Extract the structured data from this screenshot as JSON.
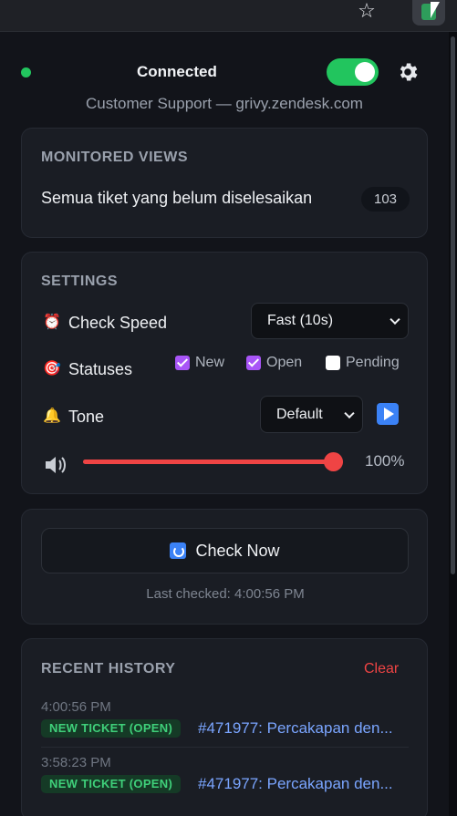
{
  "browser": {
    "star_icon": "star-icon",
    "extension_icon": "extension-icon"
  },
  "header": {
    "status_label": "Connected",
    "connected": true,
    "subtitle": "Customer Support — grivy.zendesk.com"
  },
  "monitored_views": {
    "title": "MONITORED VIEWS",
    "items": [
      {
        "label": "Semua tiket yang belum diselesaikan",
        "count": "103"
      }
    ]
  },
  "settings": {
    "title": "SETTINGS",
    "check_speed": {
      "icon": "alarm-clock-icon",
      "label": "Check Speed",
      "value": "Fast (10s)"
    },
    "statuses": {
      "icon": "target-icon",
      "label": "Statuses",
      "options": [
        {
          "label": "New",
          "checked": true
        },
        {
          "label": "Open",
          "checked": true
        },
        {
          "label": "Pending",
          "checked": false
        }
      ]
    },
    "tone": {
      "icon": "bell-icon",
      "label": "Tone",
      "value": "Default"
    },
    "volume": {
      "value_label": "100%",
      "fraction": 1.0
    }
  },
  "check": {
    "button_label": "Check Now",
    "last_checked": "Last checked: 4:00:56 PM"
  },
  "history": {
    "title": "RECENT HISTORY",
    "clear_label": "Clear",
    "items": [
      {
        "time": "4:00:56 PM",
        "tag": "NEW TICKET (OPEN)",
        "title": "#471977: Percakapan den..."
      },
      {
        "time": "3:58:23 PM",
        "tag": "NEW TICKET (OPEN)",
        "title": "#471977: Percakapan den..."
      }
    ]
  },
  "colors": {
    "accent_green": "#22c55e",
    "accent_red": "#ef4444",
    "accent_purple": "#a855f7",
    "link_blue": "#7aa5ff"
  }
}
